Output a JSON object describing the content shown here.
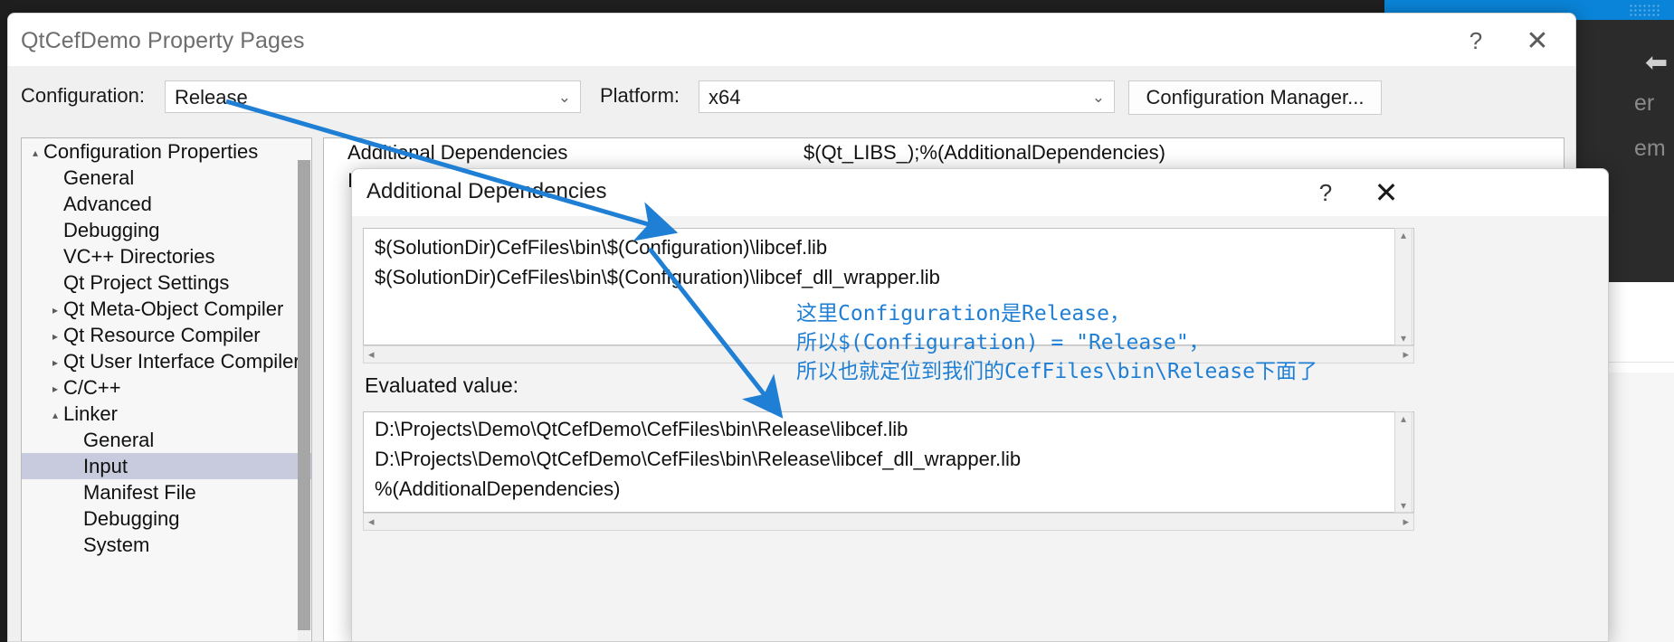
{
  "vs_background": {
    "ghost_texts": [
      "er",
      "em"
    ],
    "icons": [
      "left-arrow-icon",
      "close-icon"
    ],
    "accent_blue": "#0a84d8"
  },
  "property_pages": {
    "title": "QtCefDemo Property Pages",
    "help_label": "?",
    "close_label": "✕",
    "configuration": {
      "label": "Configuration:",
      "value": "Release",
      "chevron": "⌄"
    },
    "platform": {
      "label": "Platform:",
      "value": "x64",
      "chevron": "⌄"
    },
    "config_manager_label": "Configuration Manager..."
  },
  "tree": {
    "items": [
      {
        "label": "Configuration Properties",
        "indent": 0,
        "twisty": "▴",
        "selected": false
      },
      {
        "label": "General",
        "indent": 1,
        "twisty": "",
        "selected": false
      },
      {
        "label": "Advanced",
        "indent": 1,
        "twisty": "",
        "selected": false
      },
      {
        "label": "Debugging",
        "indent": 1,
        "twisty": "",
        "selected": false
      },
      {
        "label": "VC++ Directories",
        "indent": 1,
        "twisty": "",
        "selected": false
      },
      {
        "label": "Qt Project Settings",
        "indent": 1,
        "twisty": "",
        "selected": false
      },
      {
        "label": "Qt Meta-Object Compiler",
        "indent": 1,
        "twisty": "▸",
        "selected": false
      },
      {
        "label": "Qt Resource Compiler",
        "indent": 1,
        "twisty": "▸",
        "selected": false
      },
      {
        "label": "Qt User Interface Compiler",
        "indent": 1,
        "twisty": "▸",
        "selected": false
      },
      {
        "label": "C/C++",
        "indent": 1,
        "twisty": "▸",
        "selected": false
      },
      {
        "label": "Linker",
        "indent": 1,
        "twisty": "▴",
        "selected": false
      },
      {
        "label": "General",
        "indent": 2,
        "twisty": "",
        "selected": false
      },
      {
        "label": "Input",
        "indent": 2,
        "twisty": "",
        "selected": true
      },
      {
        "label": "Manifest File",
        "indent": 2,
        "twisty": "",
        "selected": false
      },
      {
        "label": "Debugging",
        "indent": 2,
        "twisty": "",
        "selected": false
      },
      {
        "label": "System",
        "indent": 2,
        "twisty": "",
        "selected": false
      }
    ]
  },
  "property_grid": {
    "rows": [
      {
        "name": "Additional Dependencies",
        "value": "$(Qt_LIBS_);%(AdditionalDependencies)"
      },
      {
        "name": "Ignore All Default Libraries",
        "value": ""
      }
    ]
  },
  "inner_dialog": {
    "title": "Additional Dependencies",
    "help_label": "?",
    "close_label": "✕",
    "editor_lines": [
      "$(SolutionDir)CefFiles\\bin\\$(Configuration)\\libcef.lib",
      "$(SolutionDir)CefFiles\\bin\\$(Configuration)\\libcef_dll_wrapper.lib"
    ],
    "evaluated_label": "Evaluated value:",
    "evaluated_lines": [
      "D:\\Projects\\Demo\\QtCefDemo\\CefFiles\\bin\\Release\\libcef.lib",
      "D:\\Projects\\Demo\\QtCefDemo\\CefFiles\\bin\\Release\\libcef_dll_wrapper.lib",
      "%(AdditionalDependencies)"
    ],
    "scroll_left_arrow": "◂",
    "scroll_right_arrow": "▸",
    "scroll_up_arrow": "▴",
    "scroll_down_arrow": "▾"
  },
  "annotations": {
    "color": "#1f7fd4",
    "lines": [
      "这里Configuration是Release，",
      "所以$(Configuration) = \"Release\"，",
      "所以也就定位到我们的CefFiles\\bin\\Release下面了"
    ]
  }
}
